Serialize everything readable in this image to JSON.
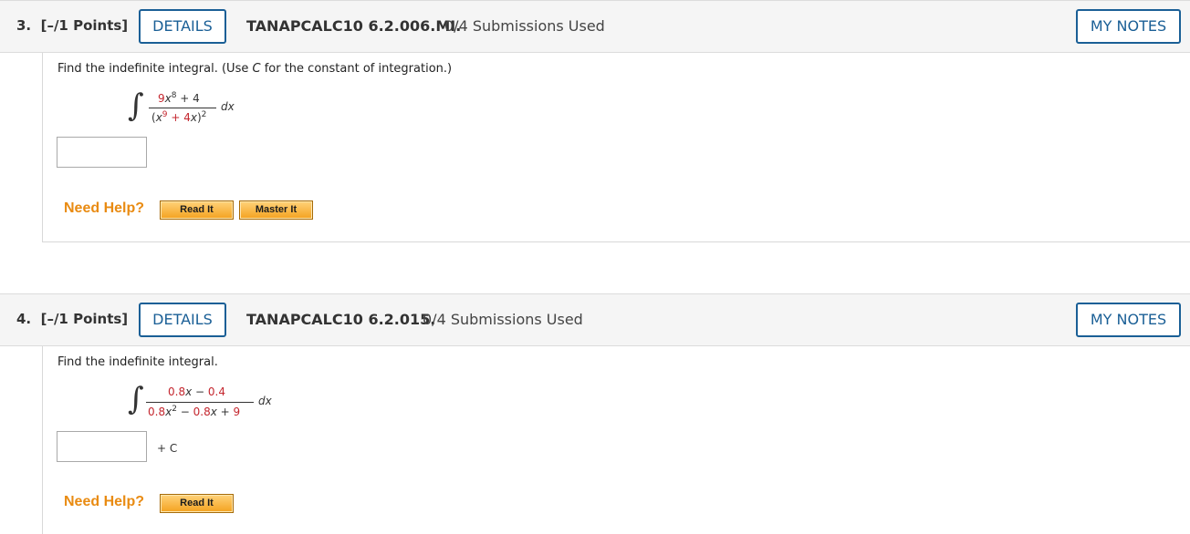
{
  "questions": [
    {
      "number": "3.",
      "points": "[–/1 Points]",
      "details_label": "DETAILS",
      "code": "TANAPCALC10 6.2.006.MI.",
      "submissions": "0/4 Submissions Used",
      "notes_label": "MY NOTES",
      "prompt_pre": "Find the indefinite integral. (Use ",
      "prompt_var": "C",
      "prompt_post": " for the constant of integration.)",
      "math": {
        "integral": "∫",
        "num_coef": "9",
        "num_var": "x",
        "num_exp": "8",
        "num_rest": " + 4",
        "den_open": "(",
        "den_var": "x",
        "den_exp": "9",
        "den_mid": " + 4",
        "den_var2": "x",
        "den_close": ")",
        "den_exp2": "2",
        "dx": "dx"
      },
      "answer_value": "",
      "need_help": "Need Help?",
      "help_buttons": [
        "Read It",
        "Master It"
      ]
    },
    {
      "number": "4.",
      "points": "[–/1 Points]",
      "details_label": "DETAILS",
      "code": "TANAPCALC10 6.2.015.",
      "submissions": "0/4 Submissions Used",
      "notes_label": "MY NOTES",
      "prompt": "Find the indefinite integral.",
      "math": {
        "integral": "∫",
        "num_a": "0.8",
        "num_var": "x",
        "num_minus": " − ",
        "num_b": "0.4",
        "den_a": "0.8",
        "den_var": "x",
        "den_exp": "2",
        "den_minus": " − ",
        "den_b": "0.8",
        "den_var2": "x",
        "den_plus": " + ",
        "den_c": "9",
        "dx": "dx"
      },
      "answer_value": "",
      "plus_c": "+ C",
      "need_help": "Need Help?",
      "help_buttons": [
        "Read It"
      ]
    }
  ],
  "colors": {
    "accent_blue": "#1a5f96",
    "help_orange": "#e98b12",
    "math_red": "#c4262e"
  }
}
